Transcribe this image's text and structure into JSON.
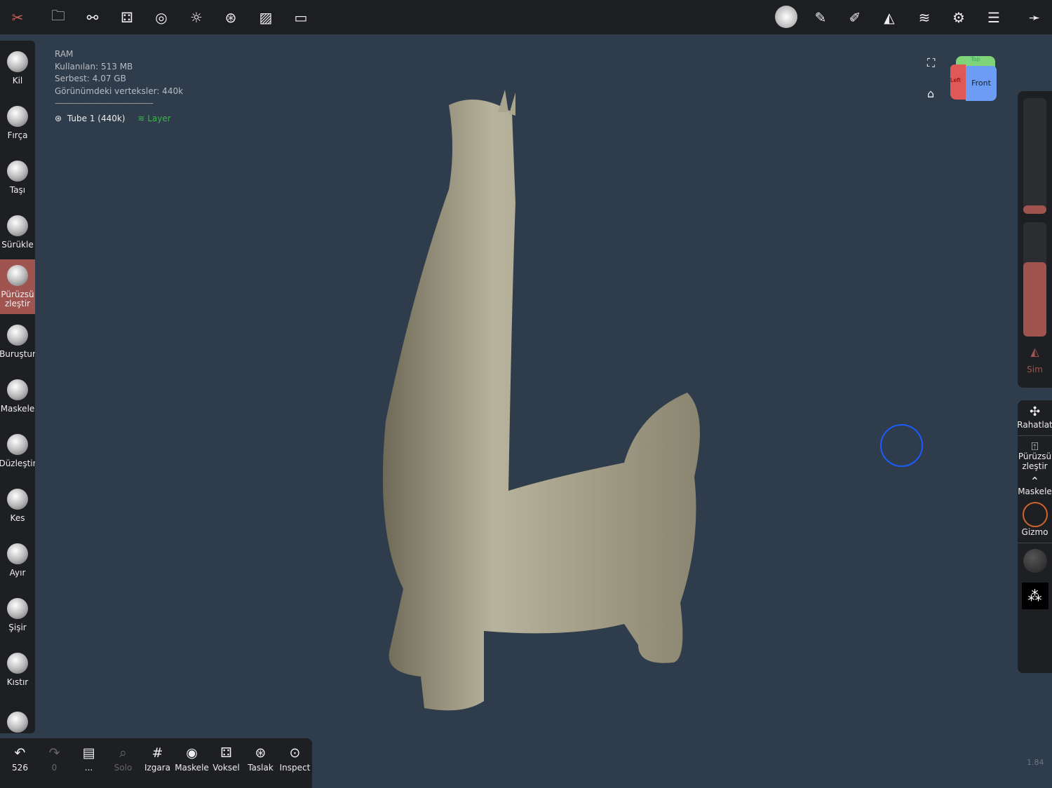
{
  "topbar": {
    "left_icons": [
      "tools-icon",
      "folder-icon",
      "share-icon",
      "scene-icon",
      "topology-icon",
      "light-icon",
      "material-icon",
      "background-image-icon",
      "camera-icon"
    ],
    "right_icons": [
      "brush-preview-icon",
      "stroke-icon",
      "paint-icon",
      "symmetry-icon",
      "layers-icon",
      "settings-icon",
      "preferences-icon",
      "hide-icon"
    ]
  },
  "info": {
    "ram": "RAM",
    "used": "Kullanılan:  513 MB",
    "free": "Serbest:  4.07 GB",
    "vertices": "Görünümdeki verteksler:  440k",
    "separator": "------------------------------------------",
    "object": "Tube 1 (440k)",
    "layer": "Layer"
  },
  "tools": [
    {
      "label": "Kil"
    },
    {
      "label": "Fırça"
    },
    {
      "label": "Taşı"
    },
    {
      "label": "Sürükle"
    },
    {
      "label": "Pürüzsü\nzleştir",
      "active": true
    },
    {
      "label": "Buruştur"
    },
    {
      "label": "Maskele"
    },
    {
      "label": "Düzleştir"
    },
    {
      "label": "Kes"
    },
    {
      "label": "Ayır"
    },
    {
      "label": "Şişir"
    },
    {
      "label": "Kıstır"
    },
    {
      "label": ""
    }
  ],
  "bottom": {
    "undo": "526",
    "redo": "0",
    "more": "...",
    "solo": "Solo",
    "grid": "Izgara",
    "mask": "Maskele",
    "voxel": "Voksel",
    "sketch": "Taslak",
    "inspect": "Inspect"
  },
  "right": {
    "radius_fraction": 0.05,
    "intensity_fraction": 0.65,
    "sym": "Sim",
    "relax": "Rahatlat",
    "smooth": "Pürüzsü\nzleştir",
    "mask": "Maskele",
    "gizmo": "Gizmo"
  },
  "cube": {
    "top": "Top",
    "left": "Left",
    "front": "Front"
  },
  "version": "1.84",
  "colors": {
    "accent": "#a0544f",
    "background": "#2f3c4b",
    "toolbar": "#1e1f22",
    "cursor": "#1a5cff"
  }
}
